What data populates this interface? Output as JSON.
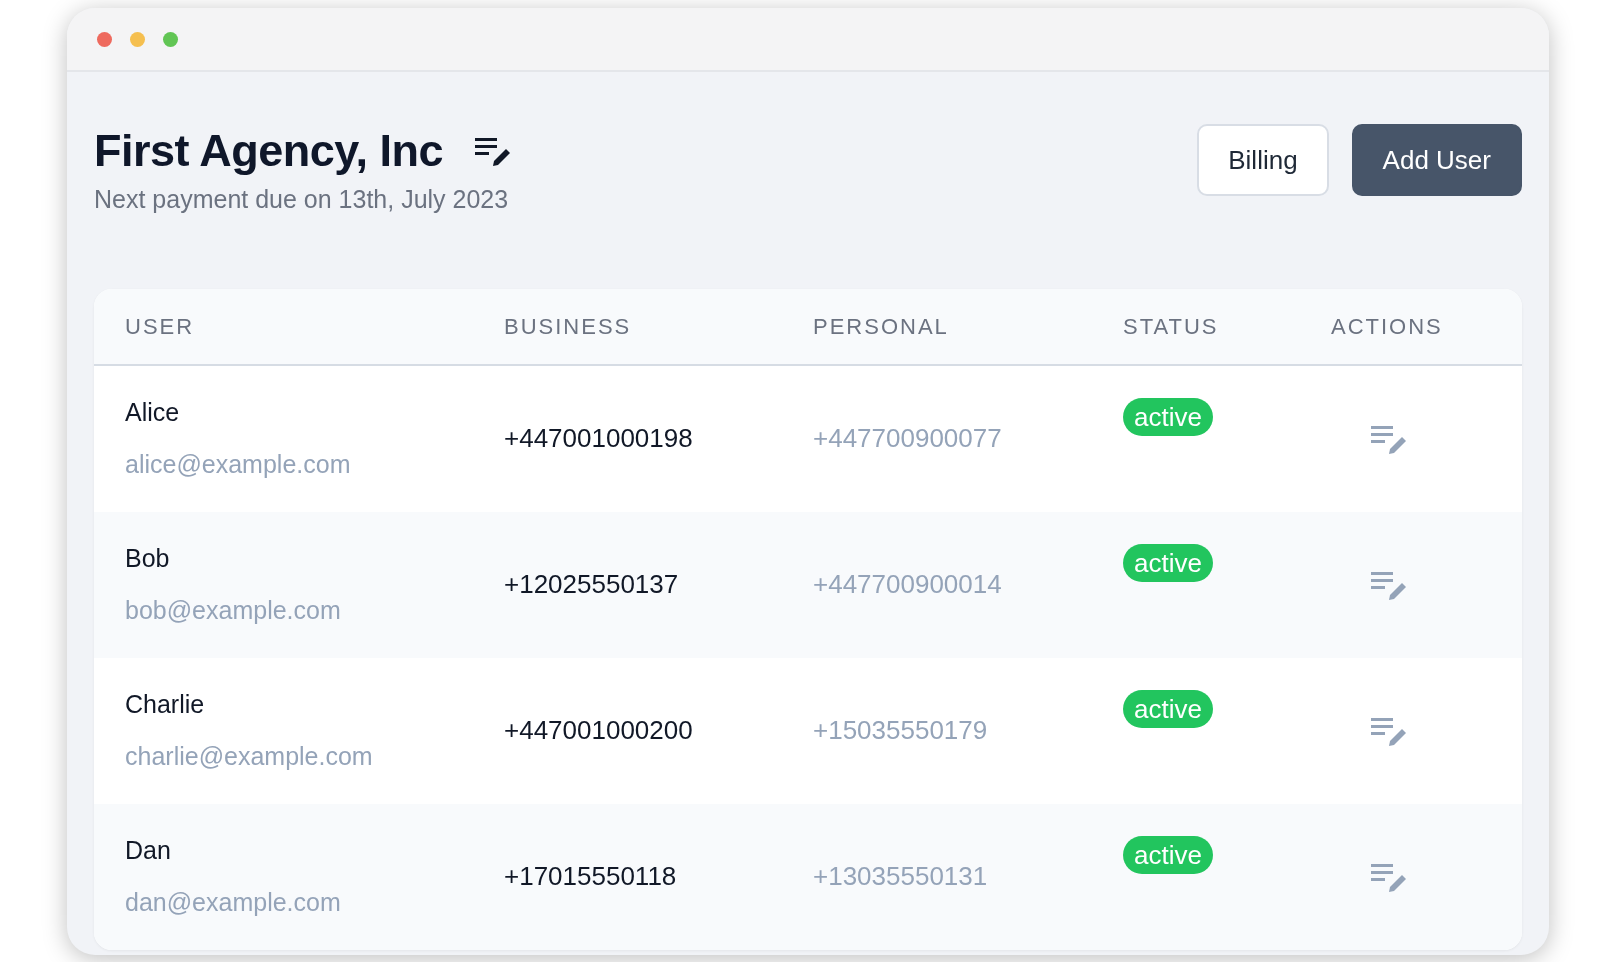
{
  "header": {
    "title": "First Agency, Inc",
    "subtitle": "Next payment due on 13th, July 2023"
  },
  "buttons": [
    {
      "label": "Billing",
      "kind": "secondary"
    },
    {
      "label": "Add User",
      "kind": "primary"
    }
  ],
  "table": {
    "columns": [
      "USER",
      "BUSINESS",
      "PERSONAL",
      "STATUS",
      "ACTIONS"
    ],
    "rows": [
      {
        "name": "Alice",
        "email": "alice@example.com",
        "business": "+447001000198",
        "personal": "+447700900077",
        "status": {
          "label": "active",
          "kind": "active"
        }
      },
      {
        "name": "Bob",
        "email": "bob@example.com",
        "business": "+12025550137",
        "personal": "+447700900014",
        "status": {
          "label": "active",
          "kind": "active"
        }
      },
      {
        "name": "Charlie",
        "email": "charlie@example.com",
        "business": "+447001000200",
        "personal": "+15035550179",
        "status": {
          "label": "active",
          "kind": "active"
        }
      },
      {
        "name": "Dan",
        "email": "dan@example.com",
        "business": "+17015550118",
        "personal": "+13035550131",
        "status": {
          "label": "active",
          "kind": "active"
        }
      }
    ]
  }
}
